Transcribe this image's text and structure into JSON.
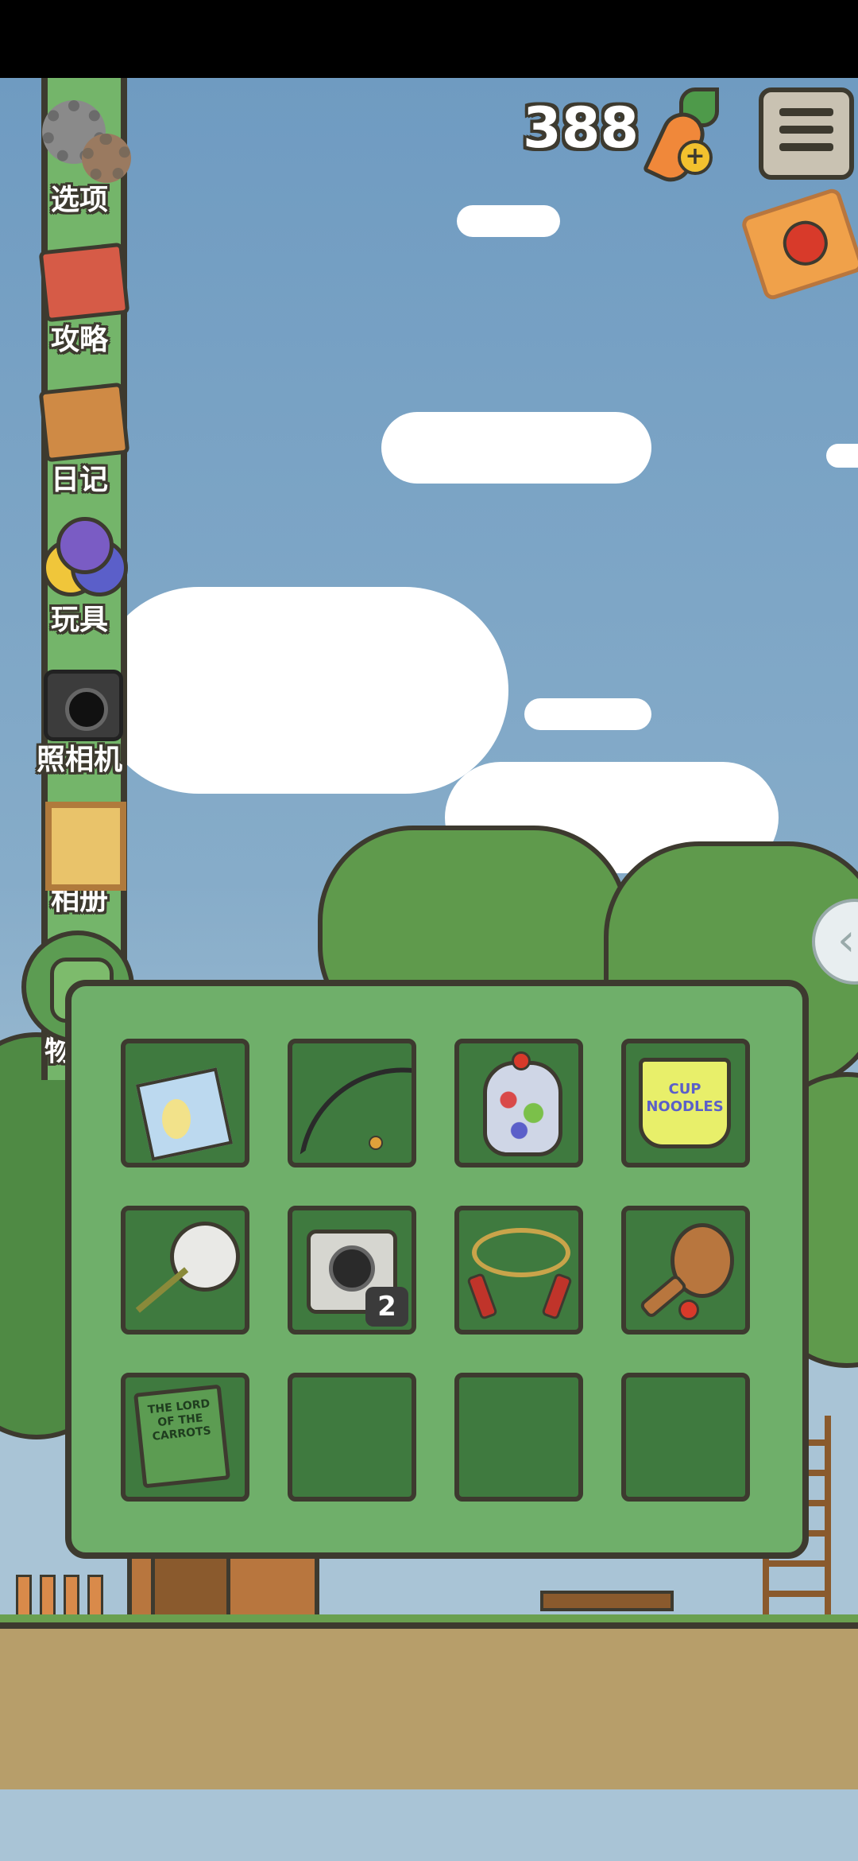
{
  "hud": {
    "carrot_count": "388",
    "icons": {
      "carrot": "carrot-plus-icon",
      "menu": "menu-icon",
      "ticket": "lucky-ticket-icon",
      "side": "collapse-arrow-icon"
    }
  },
  "sidebar": {
    "items": [
      {
        "label": "选项",
        "icon": "gear-icon"
      },
      {
        "label": "攻略",
        "icon": "guide-book-icon"
      },
      {
        "label": "日记",
        "icon": "diary-icon"
      },
      {
        "label": "玩具",
        "icon": "toy-balls-icon"
      },
      {
        "label": "照相机",
        "icon": "camera-icon"
      },
      {
        "label": "相册",
        "icon": "photo-album-icon"
      },
      {
        "label": "物品",
        "icon": "backpack-icon"
      }
    ]
  },
  "inventory": {
    "slots": [
      {
        "item": "picnic-mat",
        "count": ""
      },
      {
        "item": "fishing-rod",
        "count": ""
      },
      {
        "item": "fruit-jelly-jar",
        "count": ""
      },
      {
        "item": "cup-noodles",
        "count": ""
      },
      {
        "item": "bug-net",
        "count": ""
      },
      {
        "item": "instant-camera",
        "count": "2"
      },
      {
        "item": "jump-rope",
        "count": ""
      },
      {
        "item": "paddle-ball",
        "count": ""
      },
      {
        "item": "lord-of-the-carrots-book",
        "count": ""
      },
      {
        "item": "empty",
        "count": ""
      },
      {
        "item": "empty",
        "count": ""
      },
      {
        "item": "empty",
        "count": ""
      }
    ],
    "noodle_text": "CUP NOODLES",
    "book_text": "THE LORD OF THE CARROTS"
  },
  "colors": {
    "sky": "#86acc9",
    "panel": "#6faf6a",
    "slot": "#3f7a3f",
    "outline": "#3d3a2f"
  }
}
